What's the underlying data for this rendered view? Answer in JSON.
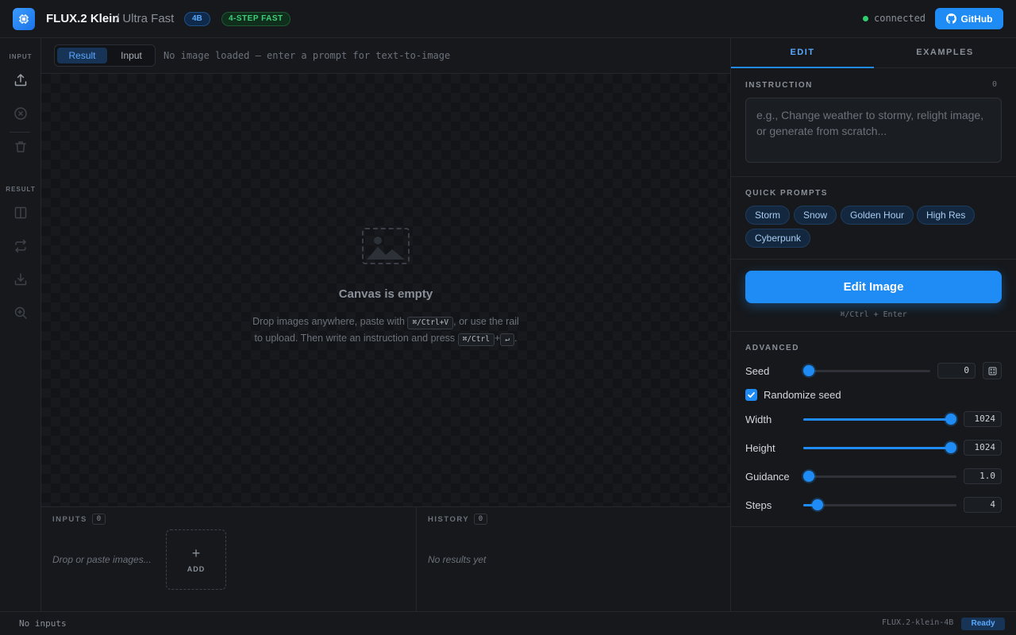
{
  "header": {
    "title": "FLUX.2 Klein",
    "subtitle": "/ Ultra Fast",
    "badge_size": "4B",
    "badge_mode": "4-STEP FAST",
    "connection_status": "connected",
    "github_label": "GitHub"
  },
  "rail": {
    "input_label": "INPUT",
    "result_label": "RESULT",
    "icons": [
      "upload-icon",
      "clear-icon",
      "trash-icon",
      "compare-icon",
      "swap-icon",
      "download-icon",
      "zoom-icon"
    ]
  },
  "toolbar": {
    "view_tabs": [
      "Result",
      "Input"
    ],
    "active_tab": "Result",
    "message": "No image loaded — enter a prompt for text-to-image"
  },
  "canvas": {
    "empty_title": "Canvas is empty",
    "desc_part1": "Drop images anywhere, paste with",
    "kbd_paste": "⌘/Ctrl+V",
    "desc_part2": ", or use the rail to upload. Then write an instruction and press",
    "kbd_mod": "⌘/Ctrl",
    "plus": "+",
    "kbd_enter": "↵",
    "period": "."
  },
  "inputs_panel": {
    "label": "INPUTS",
    "count": "0",
    "empty_text": "Drop or paste images...",
    "add_label": "ADD"
  },
  "history_panel": {
    "label": "HISTORY",
    "count": "0",
    "empty_text": "No results yet"
  },
  "status_bar": {
    "left": "No inputs",
    "model": "FLUX.2-klein-4B",
    "state": "Ready"
  },
  "right_panel": {
    "tabs": [
      "EDIT",
      "EXAMPLES"
    ],
    "active_tab": "EDIT",
    "instruction_label": "INSTRUCTION",
    "instruction_count": "0",
    "instruction_placeholder": "e.g., Change weather to stormy, relight image, or generate from scratch...",
    "quick_prompts_label": "QUICK PROMPTS",
    "quick_prompts": [
      "Storm",
      "Snow",
      "Golden Hour",
      "High Res",
      "Cyberpunk"
    ],
    "edit_button": "Edit Image",
    "shortcut_hint": "⌘/Ctrl + Enter",
    "advanced_label": "ADVANCED",
    "seed_label": "Seed",
    "seed_value": "0",
    "randomize_label": "Randomize seed",
    "randomize_checked": true,
    "width_label": "Width",
    "width_value": "1024",
    "height_label": "Height",
    "height_value": "1024",
    "guidance_label": "Guidance",
    "guidance_value": "1.0",
    "steps_label": "Steps",
    "steps_value": "4"
  },
  "colors": {
    "accent": "#1f8cf5",
    "success": "#2fd06c",
    "background": "#141619"
  }
}
